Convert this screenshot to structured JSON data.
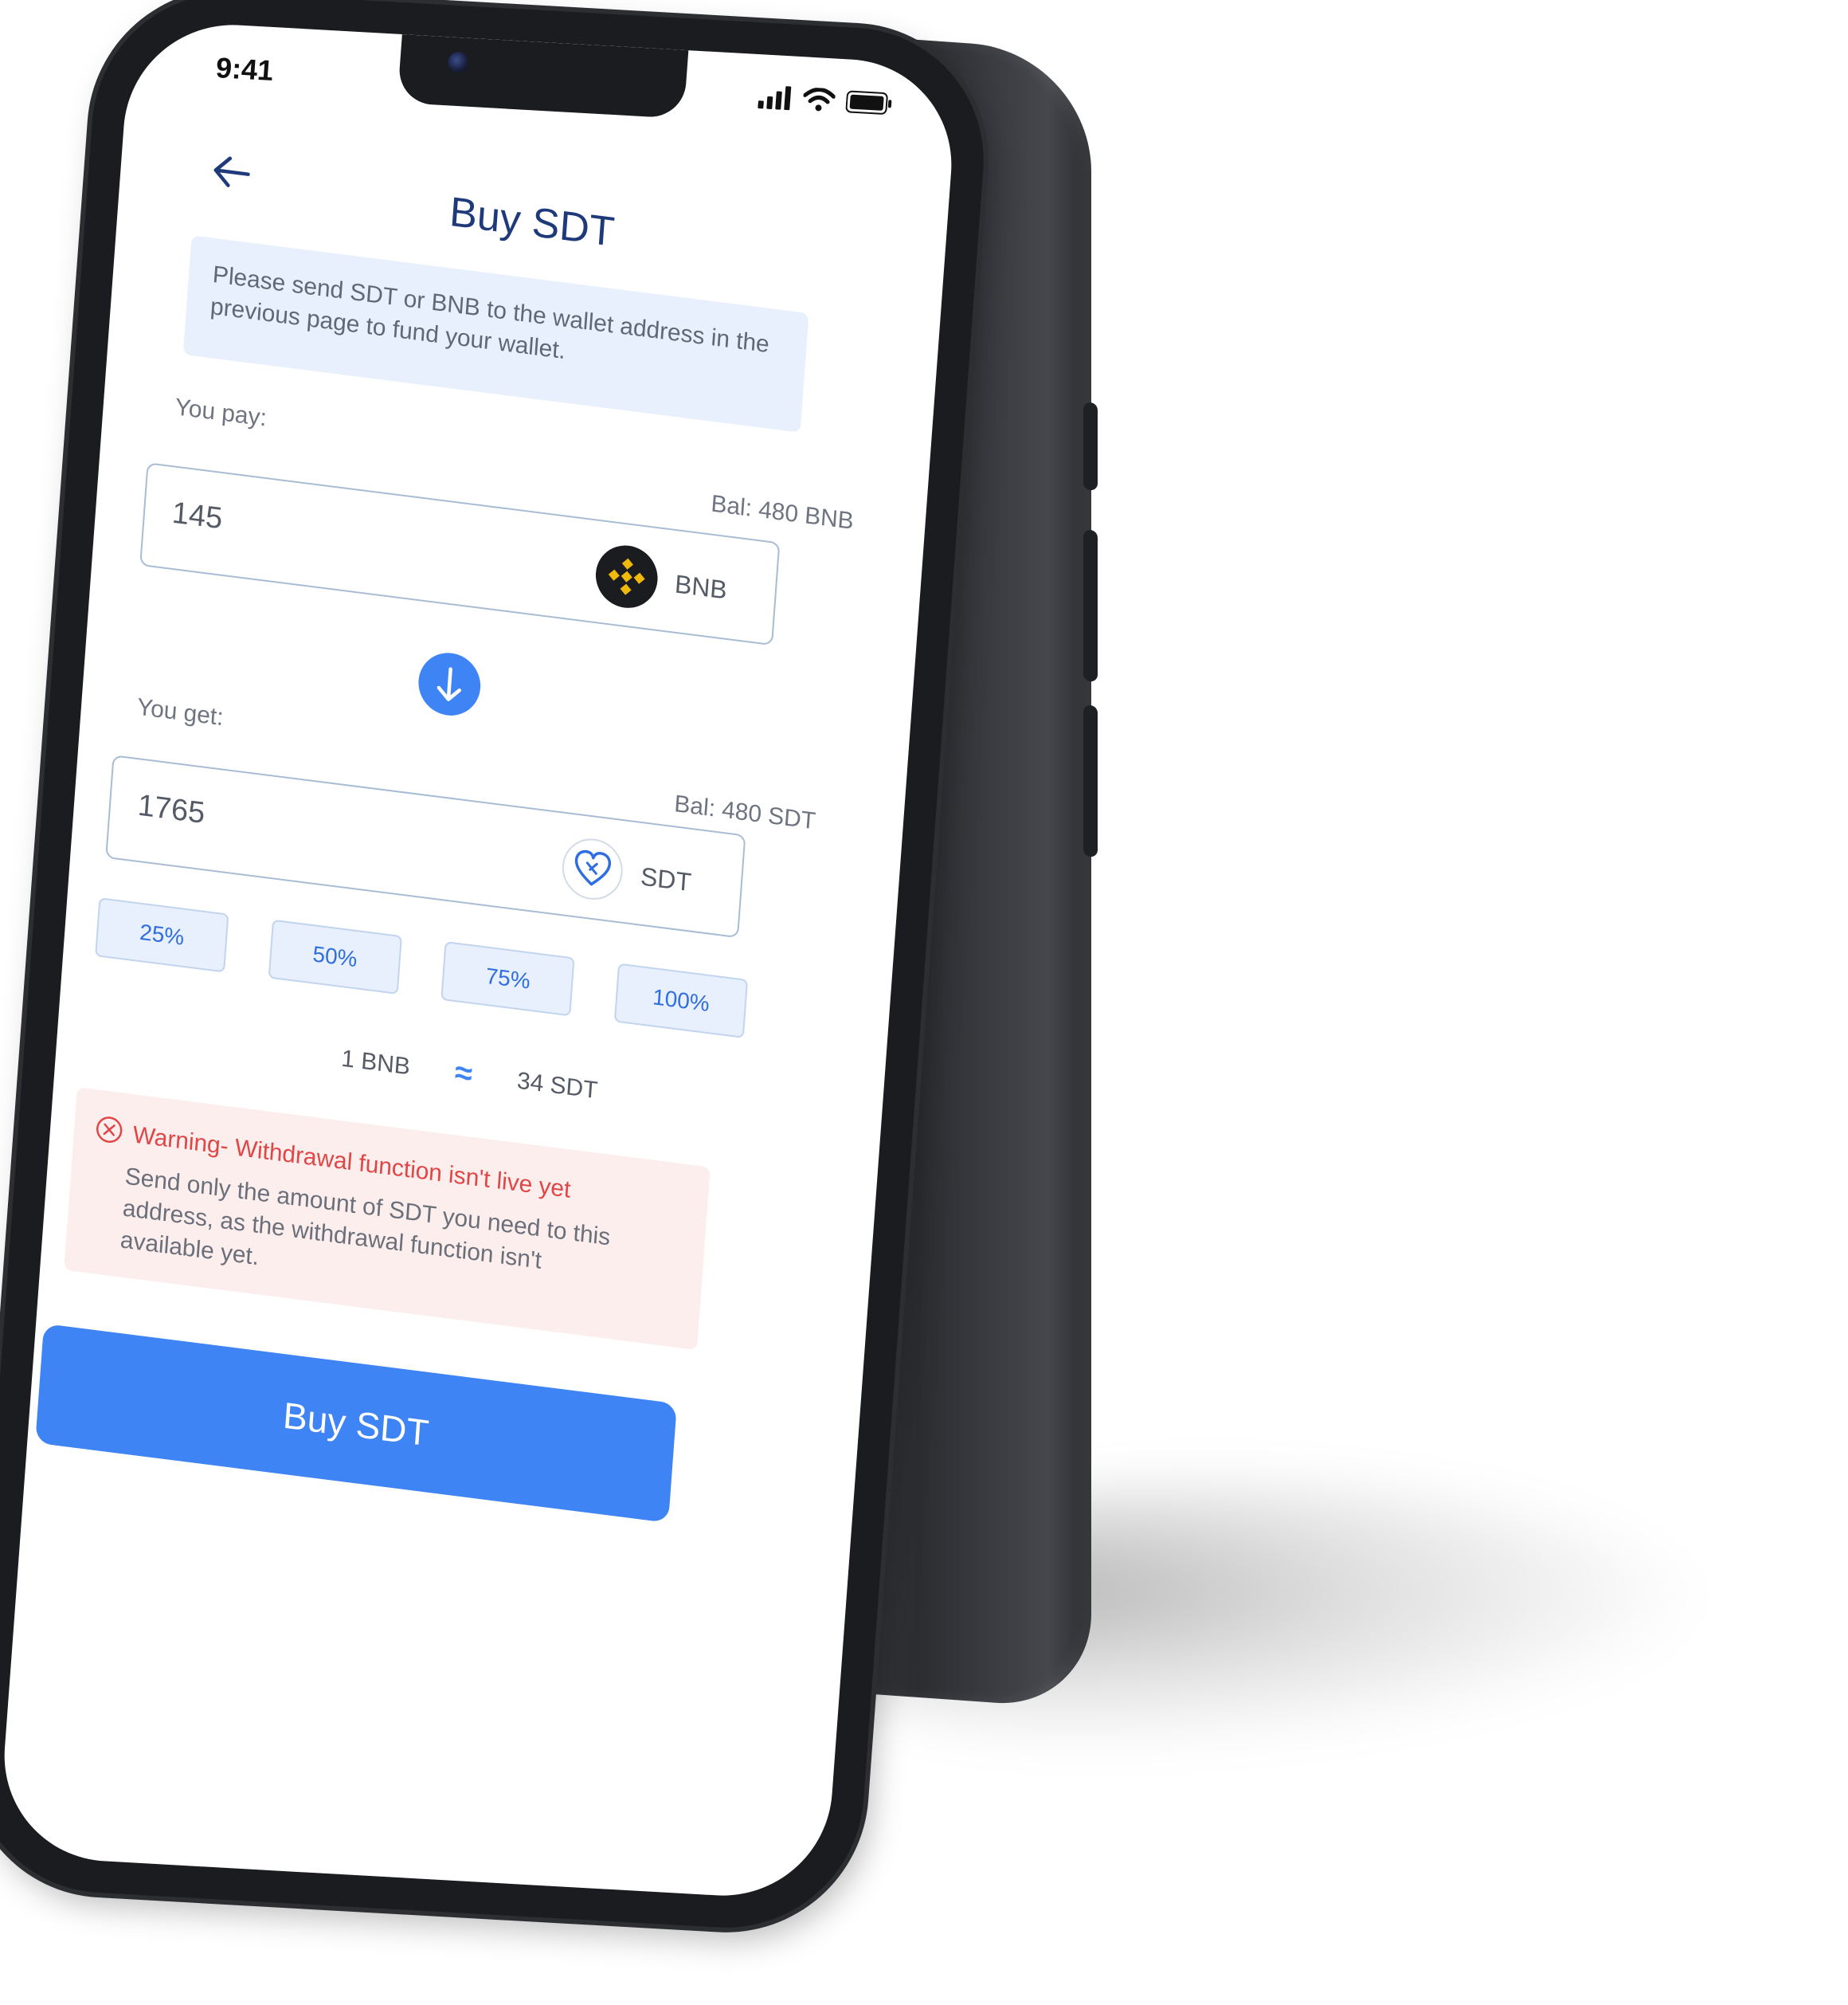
{
  "status_bar": {
    "time": "9:41"
  },
  "header": {
    "back_icon": "arrow-left-icon",
    "title": "Buy SDT"
  },
  "info": {
    "text": "Please send SDT or BNB to the wallet address in the previous page to fund your wallet."
  },
  "pay": {
    "label": "You pay:",
    "balance": "Bal: 480 BNB",
    "value": "145",
    "token": "BNB",
    "token_icon": "bnb-coin-icon"
  },
  "swap": {
    "icon": "arrow-down-icon"
  },
  "get": {
    "label": "You get:",
    "balance": "Bal: 480 SDT",
    "value": "1765",
    "token": "SDT",
    "token_icon": "sdt-heart-icon"
  },
  "percentages": [
    "25%",
    "50%",
    "75%",
    "100%"
  ],
  "rate": {
    "from": "1 BNB",
    "symbol": "≈",
    "to": "34 SDT"
  },
  "warning": {
    "icon": "close-circle-icon",
    "title": "Warning- Withdrawal function isn't live yet",
    "body": "Send only the amount of SDT you need to this address, as the withdrawal function isn't available yet."
  },
  "action": {
    "buy_label": "Buy SDT"
  },
  "colors": {
    "accent": "#3f84f4",
    "title": "#1f3a7a",
    "info_bg": "#e8f0fd",
    "warning_bg": "#fdeeee",
    "warning_text": "#e04646",
    "phone_body": "#1b1c1f"
  }
}
